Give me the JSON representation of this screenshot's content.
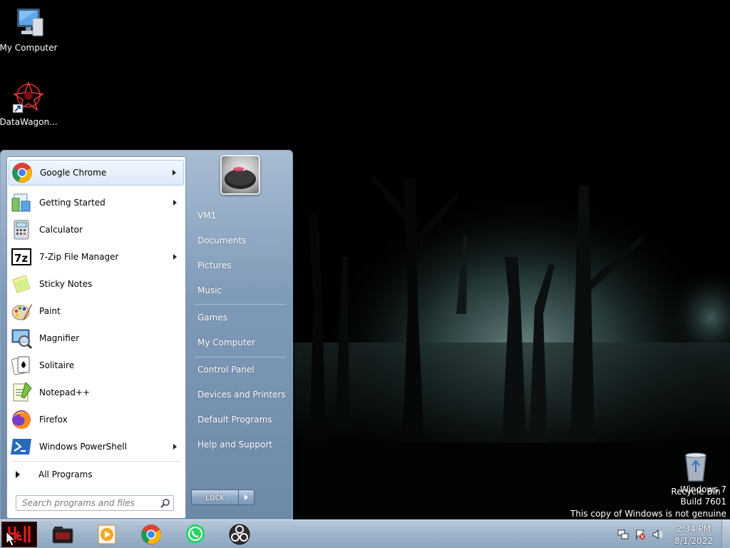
{
  "desktop": {
    "icons": [
      {
        "label": "My Computer",
        "icon": "monitor-icon"
      },
      {
        "label": "DataWagon...",
        "icon": "datawagon-icon"
      },
      {
        "label": "Recycle Bin",
        "icon": "recycle-bin-icon"
      }
    ],
    "watermark": {
      "line1": "Windows 7",
      "line2": "Build 7601",
      "line3": "This copy of Windows is not genuine"
    }
  },
  "start_menu": {
    "programs": [
      {
        "label": "Google Chrome",
        "icon": "chrome-icon",
        "has_submenu": true
      },
      {
        "label": "Getting Started",
        "icon": "getting-started-icon",
        "has_submenu": true
      },
      {
        "label": "Calculator",
        "icon": "calculator-icon",
        "has_submenu": false
      },
      {
        "label": "7-Zip File Manager",
        "icon": "7zip-icon",
        "has_submenu": true
      },
      {
        "label": "Sticky Notes",
        "icon": "sticky-notes-icon",
        "has_submenu": false
      },
      {
        "label": "Paint",
        "icon": "paint-icon",
        "has_submenu": false
      },
      {
        "label": "Magnifier",
        "icon": "magnifier-icon",
        "has_submenu": false
      },
      {
        "label": "Solitaire",
        "icon": "solitaire-icon",
        "has_submenu": false
      },
      {
        "label": "Notepad++",
        "icon": "notepadpp-icon",
        "has_submenu": false
      },
      {
        "label": "Firefox",
        "icon": "firefox-icon",
        "has_submenu": false
      },
      {
        "label": "Windows PowerShell",
        "icon": "powershell-icon",
        "has_submenu": true
      }
    ],
    "all_programs": "All Programs",
    "search_placeholder": "Search programs and files",
    "right_items": [
      "VM1",
      "Documents",
      "Pictures",
      "Music",
      "Games",
      "My Computer",
      "Control Panel",
      "Devices and Printers",
      "Default Programs",
      "Help and Support"
    ],
    "power_button": "Lock"
  },
  "taskbar": {
    "start_icon": "hell-start-icon",
    "pinned": [
      {
        "icon": "folder-explorer-icon"
      },
      {
        "icon": "media-player-icon"
      },
      {
        "icon": "chrome-icon"
      },
      {
        "icon": "whatsapp-icon"
      },
      {
        "icon": "obs-icon"
      }
    ],
    "tray_icons": [
      "network-icon",
      "action-center-flag-icon",
      "volume-icon"
    ],
    "clock": {
      "time": "2:34 PM",
      "date": "8/1/2022"
    }
  },
  "colors": {
    "start_menu_glass": "#8aa3bf",
    "taskbar": "#9fb4ca",
    "highlight": "#dceaf9"
  }
}
